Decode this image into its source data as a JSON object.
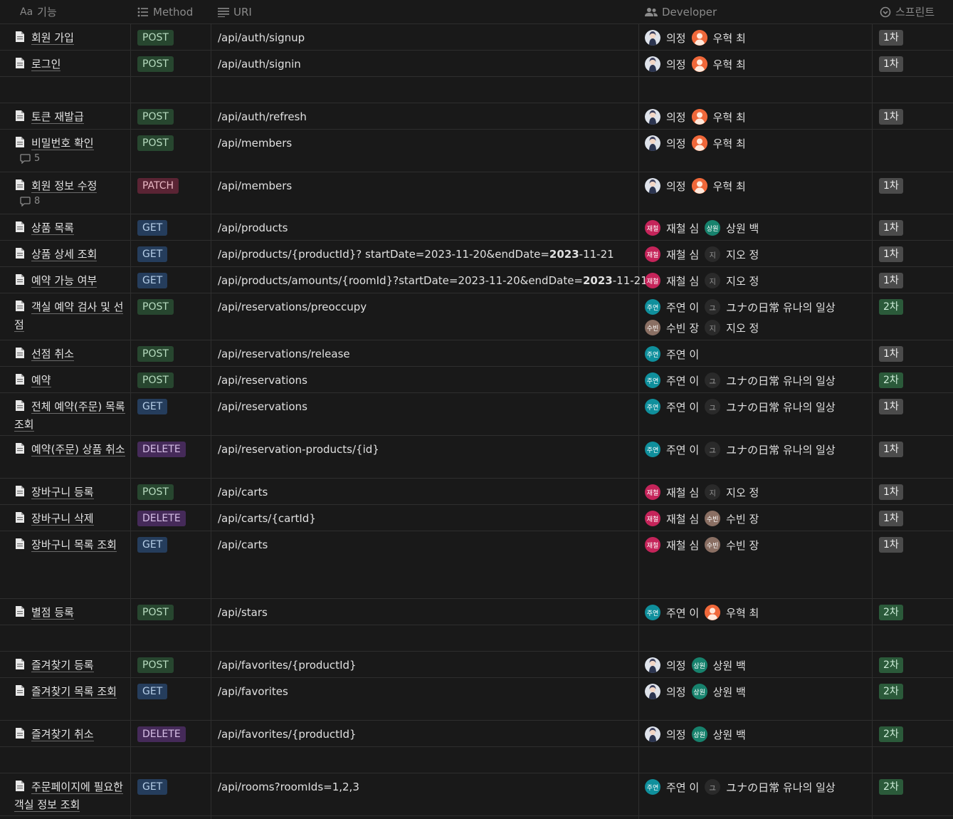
{
  "headers": {
    "feature": "기능",
    "feature_prefix": "Aa",
    "method": "Method",
    "uri": "URI",
    "developer": "Developer",
    "sprint": "스프린트"
  },
  "people": {
    "euijeong": {
      "name": "의정",
      "avatar": "photo",
      "color": "#3a4a6a"
    },
    "woohyuk": {
      "name": "우혁 최",
      "avatar": "orange-person",
      "color": "#f06a35"
    },
    "jaecheol": {
      "name": "재철 심",
      "avatar_text": "재철",
      "color": "#c5245a"
    },
    "sangwon": {
      "name": "상원 백",
      "avatar_text": "상원",
      "color": "#17826d"
    },
    "jio": {
      "name": "지오 정",
      "avatar_text": "지",
      "color": "#2a2a2a"
    },
    "juyeon": {
      "name": "주연 이",
      "avatar_text": "주연",
      "color": "#0f8f9c"
    },
    "yuna": {
      "name": "ユナの日常 유나의 일상",
      "avatar_text": "ユ",
      "color": "#2a2a2a"
    },
    "subin": {
      "name": "수빈 장",
      "avatar_text": "수빈",
      "color": "#8a6f63"
    }
  },
  "rows": [
    {
      "title": "회원 가입",
      "method": "POST",
      "uri": "/api/auth/signup",
      "devs": [
        [
          "euijeong",
          "woohyuk"
        ]
      ],
      "sprint": "1차"
    },
    {
      "title": "로그인",
      "method": "POST",
      "uri": "/api/auth/signin",
      "devs": [
        [
          "euijeong",
          "woohyuk"
        ]
      ],
      "sprint": "1차"
    },
    {
      "title": "",
      "method": "",
      "uri": "",
      "devs": [],
      "sprint": ""
    },
    {
      "title": "토큰 재발급",
      "method": "POST",
      "uri": "/api/auth/refresh",
      "devs": [
        [
          "euijeong",
          "woohyuk"
        ]
      ],
      "sprint": "1차"
    },
    {
      "title": "비밀번호 확인",
      "comments": "5",
      "method": "POST",
      "uri": "/api/members",
      "devs": [
        [
          "euijeong",
          "woohyuk"
        ]
      ],
      "sprint": ""
    },
    {
      "title": "회원 정보 수정",
      "comments": "8",
      "method": "PATCH",
      "uri": "/api/members",
      "devs": [
        [
          "euijeong",
          "woohyuk"
        ]
      ],
      "sprint": "1차"
    },
    {
      "title": "상품 목록",
      "method": "GET",
      "uri": "/api/products",
      "devs": [
        [
          "jaecheol",
          "sangwon"
        ]
      ],
      "sprint": "1차"
    },
    {
      "title": "상품 상세 조회",
      "method": "GET",
      "uri": "/api/products/{productId}? startDate=2023-11-20&endDate=",
      "uri_bold": "2023",
      "uri_tail": "-11-21",
      "devs": [
        [
          "jaecheol",
          "jio"
        ]
      ],
      "sprint": "1차"
    },
    {
      "title": "예약 가능 여부",
      "method": "GET",
      "uri": "/api/products/amounts/{roomId}?startDate=2023-11-20&endDate=",
      "uri_bold": "2023",
      "uri_tail": "-11-21",
      "devs": [
        [
          "jaecheol",
          "jio"
        ]
      ],
      "sprint": "1차"
    },
    {
      "title": "객실 예약 검사 및 선점",
      "method": "POST",
      "uri": "/api/reservations/preoccupy",
      "devs": [
        [
          "juyeon",
          "yuna"
        ],
        [
          "subin",
          "jio"
        ]
      ],
      "sprint": "2차"
    },
    {
      "title": "선점 취소",
      "method": "POST",
      "uri": "/api/reservations/release",
      "devs": [
        [
          "juyeon"
        ]
      ],
      "sprint": "1차"
    },
    {
      "title": "예약",
      "method": "POST",
      "uri": "/api/reservations",
      "devs": [
        [
          "juyeon",
          "yuna"
        ]
      ],
      "sprint": "2차"
    },
    {
      "title": "전체 예약(주문) 목록 조회",
      "method": "GET",
      "uri": "/api/reservations",
      "devs": [
        [
          "juyeon",
          "yuna"
        ]
      ],
      "sprint": "1차"
    },
    {
      "title": "예약(주문) 상품 취소",
      "method": "DELETE",
      "uri": "/api/reservation-products/{id}",
      "devs": [
        [
          "juyeon",
          "yuna"
        ]
      ],
      "sprint": "1차"
    },
    {
      "title": "장바구니 등록",
      "method": "POST",
      "uri": "/api/carts",
      "devs": [
        [
          "jaecheol",
          "jio"
        ]
      ],
      "sprint": "1차"
    },
    {
      "title": "장바구니 삭제",
      "method": "DELETE",
      "uri": "/api/carts/{cartId}",
      "devs": [
        [
          "jaecheol",
          "subin"
        ]
      ],
      "sprint": "1차"
    },
    {
      "title": "장바구니 목록 조회",
      "method": "GET",
      "uri": "/api/carts",
      "devs": [
        [
          "jaecheol",
          "subin"
        ]
      ],
      "sprint": "1차"
    },
    {
      "title": "별점 등록",
      "method": "POST",
      "uri": "/api/stars",
      "devs": [
        [
          "juyeon",
          "woohyuk"
        ]
      ],
      "sprint": "2차"
    },
    {
      "title": "",
      "method": "",
      "uri": "",
      "devs": [],
      "sprint": ""
    },
    {
      "title": "즐겨찾기 등록",
      "method": "POST",
      "uri": "/api/favorites/{productId}",
      "devs": [
        [
          "euijeong",
          "sangwon"
        ]
      ],
      "sprint": "2차"
    },
    {
      "title": "즐겨찾기 목록 조회",
      "method": "GET",
      "uri": "/api/favorites",
      "devs": [
        [
          "euijeong",
          "sangwon"
        ]
      ],
      "sprint": "2차"
    },
    {
      "title": "즐겨찾기 취소",
      "method": "DELETE",
      "uri": "/api/favorites/{productId}",
      "devs": [
        [
          "euijeong",
          "sangwon"
        ]
      ],
      "sprint": "2차"
    },
    {
      "title": "",
      "method": "",
      "uri": "",
      "devs": [],
      "sprint": ""
    },
    {
      "title": "주문페이지에 필요한 객실 정보 조회",
      "method": "GET",
      "uri": "/api/rooms?roomIds=1,2,3",
      "devs": [
        [
          "juyeon",
          "yuna"
        ]
      ],
      "sprint": "2차"
    }
  ]
}
